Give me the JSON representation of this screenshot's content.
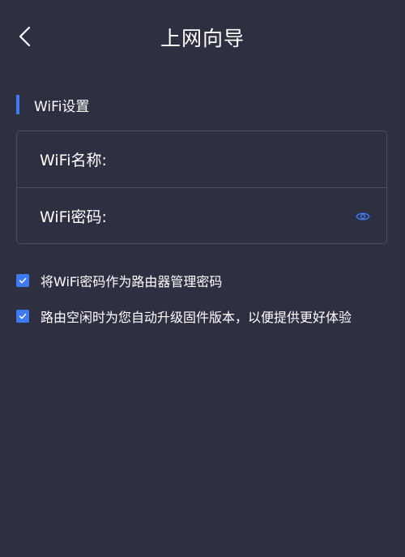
{
  "header": {
    "title": "上网向导",
    "back_icon": "chevron-left-icon"
  },
  "section": {
    "title": "WiFi设置",
    "accent_color": "#3f7bf0"
  },
  "form": {
    "ssid_label": "WiFi名称:",
    "ssid_value": "",
    "password_label": "WiFi密码:",
    "password_value": "",
    "password_toggle_icon": "eye-icon"
  },
  "options": [
    {
      "label": "将WiFi密码作为路由器管理密码",
      "checked": true
    },
    {
      "label": "路由空闲时为您自动升级固件版本，以便提供更好体验",
      "checked": true
    }
  ],
  "colors": {
    "background": "#2e3042",
    "border": "#4b4e62",
    "accent": "#3f7bf0"
  }
}
